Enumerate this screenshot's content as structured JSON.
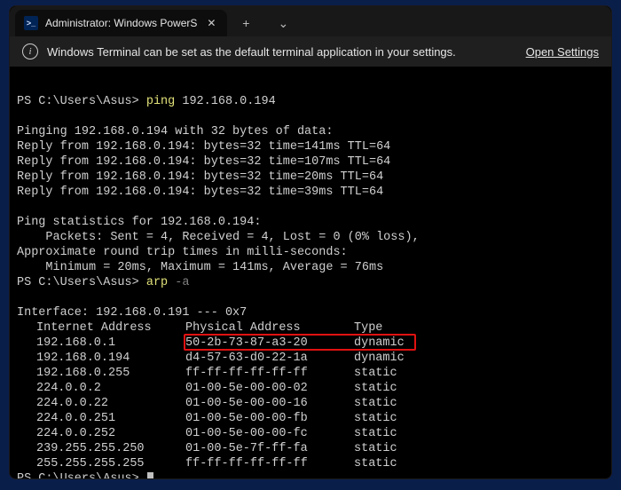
{
  "tab": {
    "title": "Administrator: Windows PowerS",
    "icon_glyph": ">_"
  },
  "tabbar": {
    "new_tab_glyph": "+",
    "dropdown_glyph": "⌄"
  },
  "infobar": {
    "message": "Windows Terminal can be set as the default terminal application in your settings.",
    "link": "Open Settings"
  },
  "term": {
    "prompt": "PS C:\\Users\\Asus>",
    "cmd1_name": "ping",
    "cmd1_arg": "192.168.0.194",
    "ping_block": "Pinging 192.168.0.194 with 32 bytes of data:\nReply from 192.168.0.194: bytes=32 time=141ms TTL=64\nReply from 192.168.0.194: bytes=32 time=107ms TTL=64\nReply from 192.168.0.194: bytes=32 time=20ms TTL=64\nReply from 192.168.0.194: bytes=32 time=39ms TTL=64",
    "stats_block": "Ping statistics for 192.168.0.194:\n    Packets: Sent = 4, Received = 4, Lost = 0 (0% loss),\nApproximate round trip times in milli-seconds:\n    Minimum = 20ms, Maximum = 141ms, Average = 76ms",
    "cmd2_name": "arp",
    "cmd2_arg": "-a",
    "interface_line": "Interface: 192.168.0.191 --- 0x7",
    "arp_headers": {
      "ip": "Internet Address",
      "phys": "Physical Address",
      "type": "Type"
    },
    "arp_rows": [
      {
        "ip": "192.168.0.1",
        "phys": "50-2b-73-87-a3-20",
        "type": "dynamic",
        "highlight": true
      },
      {
        "ip": "192.168.0.194",
        "phys": "d4-57-63-d0-22-1a",
        "type": "dynamic"
      },
      {
        "ip": "192.168.0.255",
        "phys": "ff-ff-ff-ff-ff-ff",
        "type": "static"
      },
      {
        "ip": "224.0.0.2",
        "phys": "01-00-5e-00-00-02",
        "type": "static"
      },
      {
        "ip": "224.0.0.22",
        "phys": "01-00-5e-00-00-16",
        "type": "static"
      },
      {
        "ip": "224.0.0.251",
        "phys": "01-00-5e-00-00-fb",
        "type": "static"
      },
      {
        "ip": "224.0.0.252",
        "phys": "01-00-5e-00-00-fc",
        "type": "static"
      },
      {
        "ip": "239.255.255.250",
        "phys": "01-00-5e-7f-ff-fa",
        "type": "static"
      },
      {
        "ip": "255.255.255.255",
        "phys": "ff-ff-ff-ff-ff-ff",
        "type": "static"
      }
    ]
  }
}
